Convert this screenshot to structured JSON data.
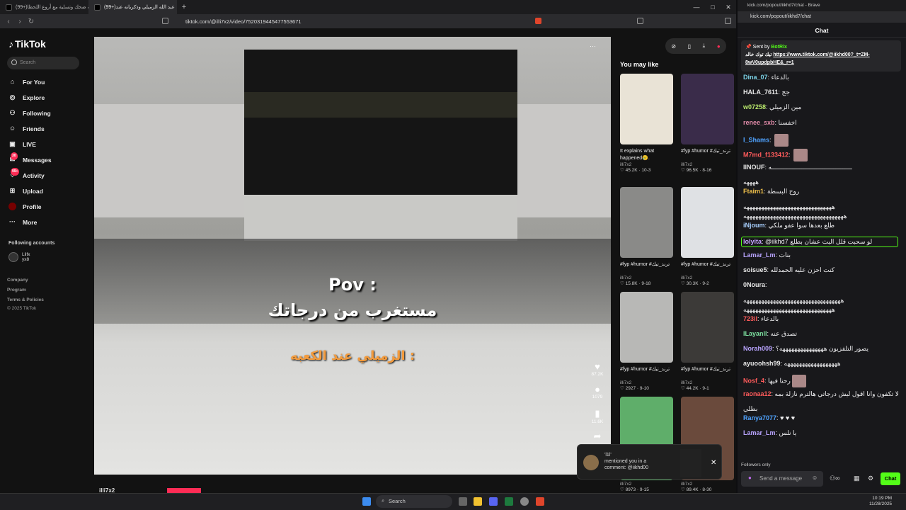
{
  "browser": {
    "tabs": [
      {
        "title": "(99+)لعبة ضحك وتسلية مع أروع اللحظا"
      },
      {
        "title": "(99+)عبد الله الزميلي وذكرياته عند"
      }
    ],
    "new_tab": "+",
    "url": "tiktok.com/@illi7x2/video/7520319445477553671",
    "win_min": "—",
    "win_max": "□",
    "win_close": "✕"
  },
  "sidebar": {
    "logo": "TikTok",
    "search_placeholder": "Search",
    "items": [
      {
        "label": "For You",
        "icon": "home-icon"
      },
      {
        "label": "Explore",
        "icon": "compass-icon"
      },
      {
        "label": "Following",
        "icon": "following-icon"
      },
      {
        "label": "Friends",
        "icon": "friends-icon"
      },
      {
        "label": "LIVE",
        "icon": "live-icon"
      },
      {
        "label": "Messages",
        "icon": "message-icon",
        "badge": "30"
      },
      {
        "label": "Activity",
        "icon": "activity-icon",
        "badge": "99+"
      },
      {
        "label": "Upload",
        "icon": "upload-icon"
      },
      {
        "label": "Profile",
        "icon": "profile-icon"
      },
      {
        "label": "More",
        "icon": "more-icon"
      }
    ],
    "following_accounts_title": "Following accounts",
    "account": {
      "name": "Lilfx",
      "handle": "yx8"
    },
    "footer": [
      "Company",
      "Program",
      "Terms & Policies",
      "© 2025 TikTok"
    ]
  },
  "video": {
    "pov_line1": "Pov :",
    "pov_line2": "مستغرب من درجاتك",
    "orange_text": "الزميلي عند الكعبه :",
    "likes": "87.2K",
    "comments": "1079",
    "saves": "11.6K",
    "username": "illi7x2",
    "more": "···"
  },
  "recommend": {
    "title": "You may like",
    "cards": [
      {
        "caption": "It explains what happened😢.",
        "user": "illi7x2",
        "stats": "♡ 45.2K · 10-3"
      },
      {
        "caption": "#fyp #humor #ترند_تيك",
        "user": "illi7x2",
        "stats": "♡ 96.5K · 8-16"
      },
      {
        "caption": "#fyp #humor #ترند_تيك",
        "user": "illi7x2",
        "stats": "♡ 15.8K · 9-18"
      },
      {
        "caption": "#fyp #humor #ترند_تيك",
        "user": "illi7x2",
        "stats": "♡ 30.3K · 9-2"
      },
      {
        "caption": "#fyp #humor #ترند_تيك",
        "user": "illi7x2",
        "stats": "♡ 2927 · 9-10"
      },
      {
        "caption": "#fyp #humor #ترند_تيك",
        "user": "illi7x2",
        "stats": "♡ 44.2K · 9-1"
      },
      {
        "caption": "",
        "user": "illi7x2",
        "stats": "♡ 8973 · 9-15"
      },
      {
        "caption": "",
        "user": "illi7x2",
        "stats": "♡ 89.4K · 8-30"
      }
    ]
  },
  "notification": {
    "user": "'l1l'",
    "text1": "mentioned you in a",
    "text2": "comment: @iikhd00",
    "close": "✕"
  },
  "chat_window": {
    "tab_title": "kick.com/popout/iikhd7/chat - Brave",
    "url": "kick.com/popout/iikhd7/chat",
    "header": "Chat",
    "pinned": {
      "sent_by": "Sent by",
      "bot": "BotRix",
      "text": "تيك توك خالد",
      "link": "https://www.tiktok.com/@iikhd00?_t=ZM-8wV0updpbHE&_r=1"
    },
    "messages": [
      {
        "user": "Dina_07",
        "color": "#7bd2e6",
        "text": "بالدعاء"
      },
      {
        "user": "HALA_7611",
        "color": "#e7e7e7",
        "text": "جج"
      },
      {
        "user": "w07258",
        "color": "#b7e66b",
        "text": "مين الزميلي"
      },
      {
        "user": "renee_sxb",
        "color": "#e08aa8",
        "text": "اخفسنا"
      },
      {
        "user": "I_Shams",
        "color": "#4fa3ff",
        "text": ""
      },
      {
        "user": "M7md_f133412",
        "color": "#ff5b5b",
        "text": ""
      },
      {
        "user": "IINOUF",
        "color": "#e7e7e7",
        "text": "ـــــــــــــــــــــــــــــــــــــــــــه"
      },
      {
        "user": "",
        "color": "#e7e7e7",
        "text": "ههههه"
      },
      {
        "user": "Ftaim1",
        "color": "#f0c14b",
        "text": "روح البسطة"
      },
      {
        "user": "",
        "color": "#e7e7e7",
        "text": "ههههههههههههههههههههههههههههههه"
      },
      {
        "user": "",
        "color": "#e7e7e7",
        "text": "ههههههههههههههههههههههههههههههههههه"
      },
      {
        "user": "iNjoum",
        "color": "#a8d0ff",
        "text": "طلع بعدها سوا عفو ملكي"
      },
      {
        "user": "lolyita",
        "color": "#c6a4ff",
        "text": "@iikhd7 لو سحبت قلل البث عشان بطلع"
      },
      {
        "user": "Lamar_Lm",
        "color": "#b9a4ff",
        "text": "بنات"
      },
      {
        "user": "soisue5",
        "color": "#e7e7e7",
        "text": "كنت احزن عليه الحمدلله"
      },
      {
        "user": "0Noura",
        "color": "#e7e7e7",
        "text": ""
      },
      {
        "user": "",
        "color": "#e7e7e7",
        "text": "هههههههههههههههههههههههههههههههههه"
      },
      {
        "user": "",
        "color": "#e7e7e7",
        "text": "ههههههههههههههههههههههههههههههه"
      },
      {
        "user": "723il",
        "color": "#ff5b5b",
        "text": "بالدعاء"
      },
      {
        "user": "ILayanll",
        "color": "#7de0a0",
        "text": "تصدق عنه"
      },
      {
        "user": "Norah009",
        "color": "#b9a4ff",
        "text": "يصور التلفزيون هههههههههههههههه؟"
      },
      {
        "user": "ayuoohsh99",
        "color": "#e7e7e7",
        "text": "ههههههههههههههههههه"
      },
      {
        "user": "Nosf_4",
        "color": "#ff5b5b",
        "text": "رحنا فيها"
      },
      {
        "user": "raonaa12",
        "color": "#ff5b5b",
        "text": "لا تكفون وانا اقول ليش درجاتي هالترم نازلة بمه"
      },
      {
        "user": "",
        "color": "#e7e7e7",
        "text": "بطلي"
      },
      {
        "user": "Ranya7077",
        "color": "#4fa3ff",
        "text": "♥ ♥ ♥"
      },
      {
        "user": "Lamar_Lm",
        "color": "#b9a4ff",
        "text": "يا نلس"
      }
    ],
    "followers_only": "Followers only",
    "input_placeholder": "Send a message",
    "chat_button": "Chat"
  },
  "taskbar": {
    "search": "Search",
    "time": "10:19 PM",
    "date": "11/28/2025"
  }
}
